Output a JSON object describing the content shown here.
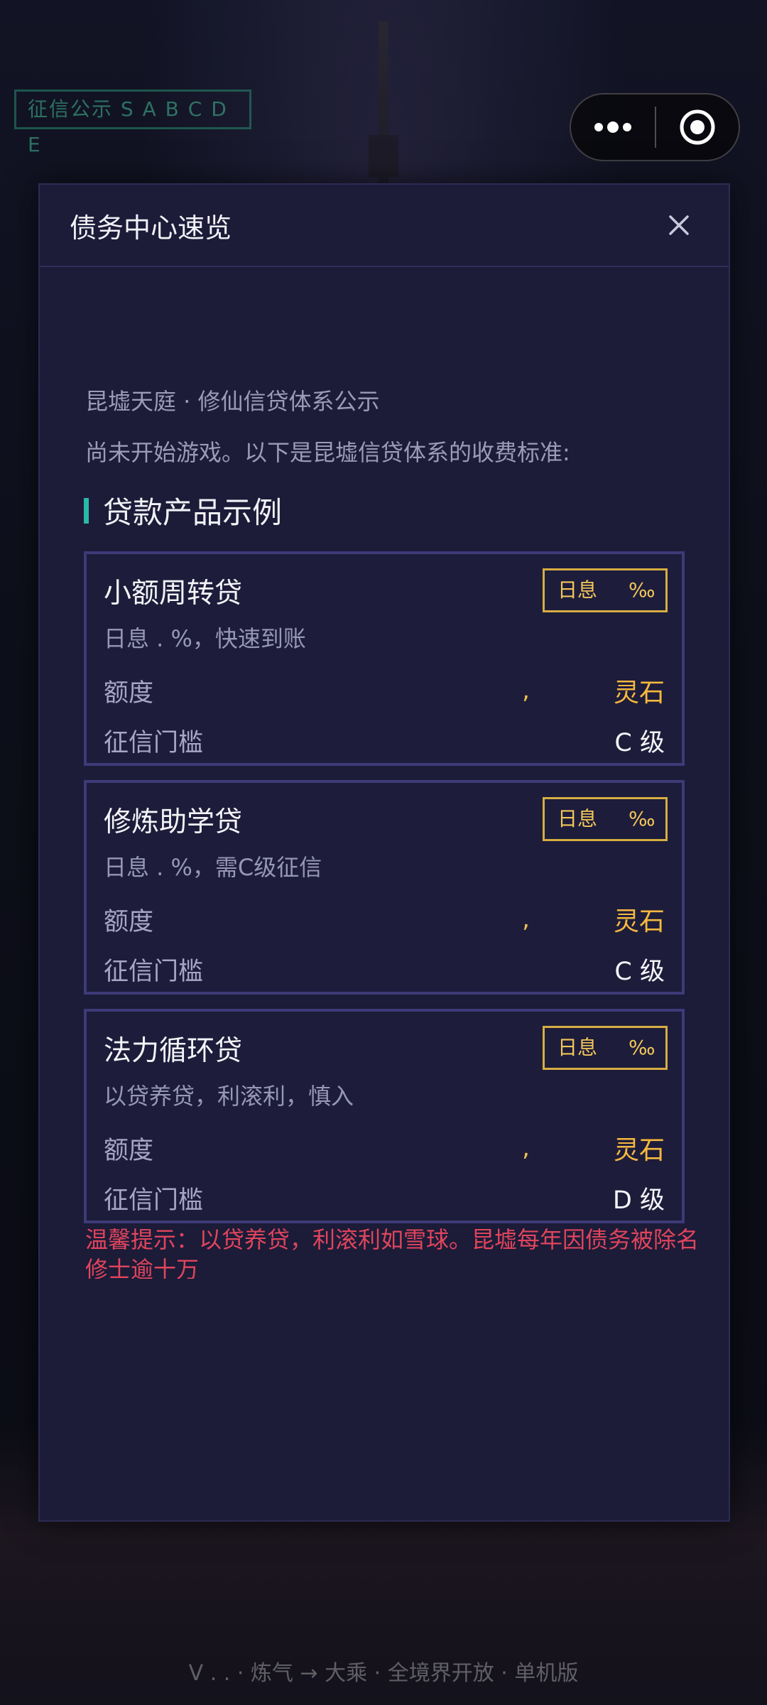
{
  "background": {
    "credit_tag": "征信公示 S A B C D E",
    "footer": "V . . · 炼气 → 大乘 · 全境界开放 · 单机版"
  },
  "capsule": {
    "more_icon": "more-dots-icon",
    "close_icon": "miniprogram-close-icon"
  },
  "modal": {
    "title": "债务中心速览",
    "close_icon": "close-x-icon",
    "intro_line1": "昆墟天庭 · 修仙信贷体系公示",
    "intro_line2": "尚未开始游戏。以下是昆墟信贷体系的收费标准:",
    "section_title": "贷款产品示例",
    "amount_label": "额度",
    "threshold_label": "征信门槛",
    "cards": [
      {
        "name": "小额周转贷",
        "badge_prefix": "日息",
        "badge_unit": "‰",
        "desc": "日息  .  %，快速到账",
        "amount_comma": ",",
        "amount_unit": "灵石",
        "grade": "C 级"
      },
      {
        "name": "修炼助学贷",
        "badge_prefix": "日息",
        "badge_unit": "‰",
        "desc": "日息  .    %，需C级征信",
        "amount_comma": ",",
        "amount_unit": "灵石",
        "grade": "C 级"
      },
      {
        "name": "法力循环贷",
        "badge_prefix": "日息",
        "badge_unit": "‰",
        "desc": "以贷养贷，利滚利，慎入",
        "amount_comma": ",",
        "amount_unit": "灵石",
        "grade": "D 级"
      }
    ],
    "warning": "温馨提示：以贷养贷，利滚利如雪球。昆墟每年因债务被除名修士逾十万"
  },
  "colors": {
    "modal_bg": "#1c1b38",
    "card_border": "#3e3a78",
    "accent_gold": "#d6ad42",
    "accent_teal": "#2bb8a8",
    "warning_red": "#e0455c"
  }
}
